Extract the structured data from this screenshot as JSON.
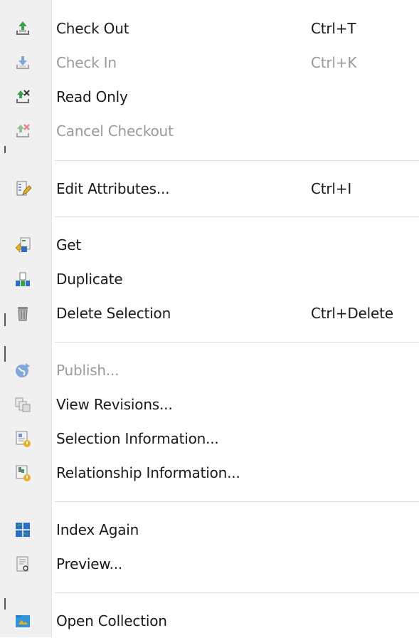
{
  "menu": {
    "items": [
      {
        "label": "Check Out",
        "shortcut": "Ctrl+T",
        "icon": "check-out-icon",
        "enabled": true
      },
      {
        "label": "Check In",
        "shortcut": "Ctrl+K",
        "icon": "check-in-icon",
        "enabled": false
      },
      {
        "label": "Read Only",
        "shortcut": "",
        "icon": "read-only-icon",
        "enabled": true
      },
      {
        "label": "Cancel Checkout",
        "shortcut": "",
        "icon": "cancel-checkout-icon",
        "enabled": false
      },
      {
        "label": "Edit Attributes...",
        "shortcut": "Ctrl+I",
        "icon": "edit-attributes-icon",
        "enabled": true
      },
      {
        "label": "Get",
        "shortcut": "",
        "icon": "get-icon",
        "enabled": true
      },
      {
        "label": "Duplicate",
        "shortcut": "",
        "icon": "duplicate-icon",
        "enabled": true
      },
      {
        "label": "Delete Selection",
        "shortcut": "Ctrl+Delete",
        "icon": "trash-icon",
        "enabled": true
      },
      {
        "label": "Publish...",
        "shortcut": "",
        "icon": "publish-globe-icon",
        "enabled": false
      },
      {
        "label": "View Revisions...",
        "shortcut": "",
        "icon": "view-revisions-icon",
        "enabled": true
      },
      {
        "label": "Selection Information...",
        "shortcut": "",
        "icon": "selection-info-icon",
        "enabled": true
      },
      {
        "label": "Relationship Information...",
        "shortcut": "",
        "icon": "relationship-info-icon",
        "enabled": true
      },
      {
        "label": "Index Again",
        "shortcut": "",
        "icon": "index-again-icon",
        "enabled": true
      },
      {
        "label": "Preview...",
        "shortcut": "",
        "icon": "preview-icon",
        "enabled": true
      },
      {
        "label": "Open Collection",
        "shortcut": "",
        "icon": "folder-icon",
        "enabled": true
      }
    ]
  },
  "colors": {
    "text": "#1a1a1a",
    "disabled_text": "#9a9a9a",
    "gutter": "#f0f0f0",
    "separator": "#dcdcdc",
    "accent_green": "#3aa34a",
    "accent_blue": "#2a6fc9",
    "accent_red": "#d9302a"
  }
}
